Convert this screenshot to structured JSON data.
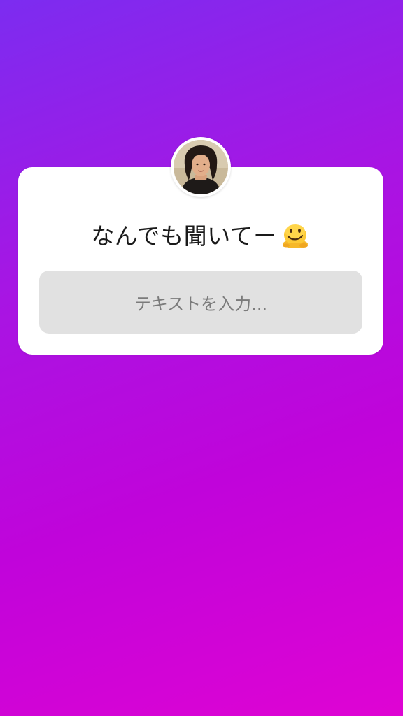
{
  "story": {
    "background_gradient": [
      "#7c2cf0",
      "#a815e3",
      "#c004da",
      "#df04d3"
    ]
  },
  "question_sticker": {
    "avatar_icon": "profile-photo",
    "question_text": "なんでも聞いてー",
    "emoji_icon": "melting-face-emoji",
    "answer_placeholder": "テキストを入力..."
  }
}
